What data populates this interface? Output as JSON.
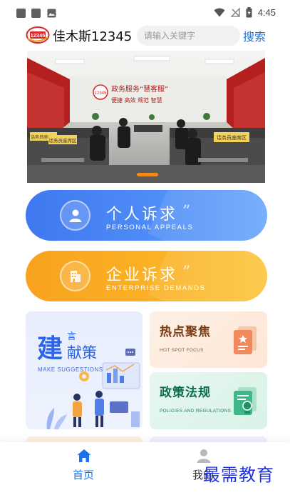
{
  "status_bar": {
    "time": "4:45"
  },
  "header": {
    "logo_text": "12345",
    "title": "佳木斯12345",
    "search_placeholder": "请输入关键字",
    "search_label": "搜索"
  },
  "banner": {
    "wall_slogan": "政务服务“慧客服”",
    "wall_line2": "便捷  高效  规范  智慧",
    "zone_label_left": "话务员座席区",
    "zone_label_mid": "话务员座席区",
    "zone_label_right": "话务员座席区"
  },
  "appeals": {
    "personal": {
      "title": "个人诉求",
      "subtitle": "PERSONAL  APPEALS",
      "color": "#4a86f5"
    },
    "enterprise": {
      "title": "企业诉求",
      "subtitle": "ENTERPRISE  DEMANDS",
      "color": "#f9ab22"
    }
  },
  "cards": {
    "suggest": {
      "big": "建",
      "small": "言",
      "mid": "献策",
      "en": "MAKE SUGGESTIONS"
    },
    "hot": {
      "title": "热点聚焦",
      "en": "HOT SPOT FOCUS"
    },
    "policy": {
      "title": "政策法规",
      "en": "POLICIES AND REGULATIONS"
    }
  },
  "nav": {
    "home": "首页",
    "mine": "我的"
  },
  "watermark": "最需教育",
  "icons": {
    "status": [
      "app-icon",
      "app-icon",
      "image-icon",
      "wifi-icon",
      "signal-icon",
      "battery-icon"
    ],
    "nav_home": "home-icon",
    "nav_mine": "user-icon"
  }
}
